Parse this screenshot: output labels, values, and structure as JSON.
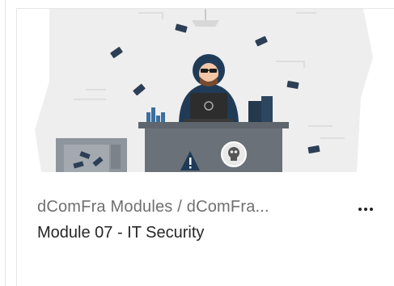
{
  "course_card": {
    "breadcrumb": "dComFra Modules / dComFra...",
    "title": "Module 07 - IT Security",
    "more_icon": "more-horizontal-icon",
    "banner_illustration": "hacker-at-desk-illustration"
  },
  "colors": {
    "banner_background": "#eeeeee",
    "desk": "#6a7178",
    "hoodie": "#1f3b57",
    "breadcrumb_text": "#6f6f6f",
    "title_text": "#262626"
  }
}
